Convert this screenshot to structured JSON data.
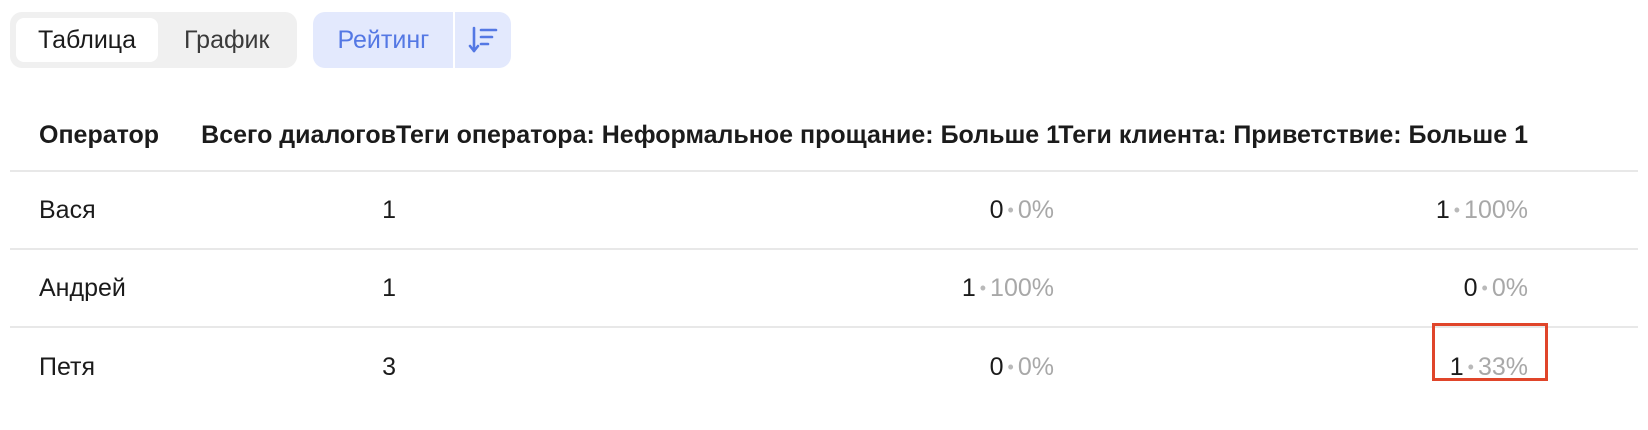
{
  "toolbar": {
    "tabs": [
      {
        "label": "Таблица",
        "active": true
      },
      {
        "label": "График",
        "active": false
      }
    ],
    "rating_label": "Рейтинг",
    "sort_icon": "sort-descending-icon"
  },
  "table": {
    "headers": {
      "operator": "Оператор",
      "total": "Всего диалогов",
      "operator_tags": "Теги оператора: Неформальное прощание: Больше 1",
      "client_tags": "Теги клиента: Приветствие: Больше 1"
    },
    "rows": [
      {
        "operator": "Вася",
        "total": "1",
        "op_count": "0",
        "op_pct": "0%",
        "cl_count": "1",
        "cl_pct": "100%"
      },
      {
        "operator": "Андрей",
        "total": "1",
        "op_count": "1",
        "op_pct": "100%",
        "cl_count": "0",
        "cl_pct": "0%"
      },
      {
        "operator": "Петя",
        "total": "3",
        "op_count": "0",
        "op_pct": "0%",
        "cl_count": "1",
        "cl_pct": "33%"
      }
    ],
    "separator": "•"
  },
  "colors": {
    "accent": "#5478e4",
    "highlight": "#e0452a",
    "muted": "#a8a8a8"
  }
}
